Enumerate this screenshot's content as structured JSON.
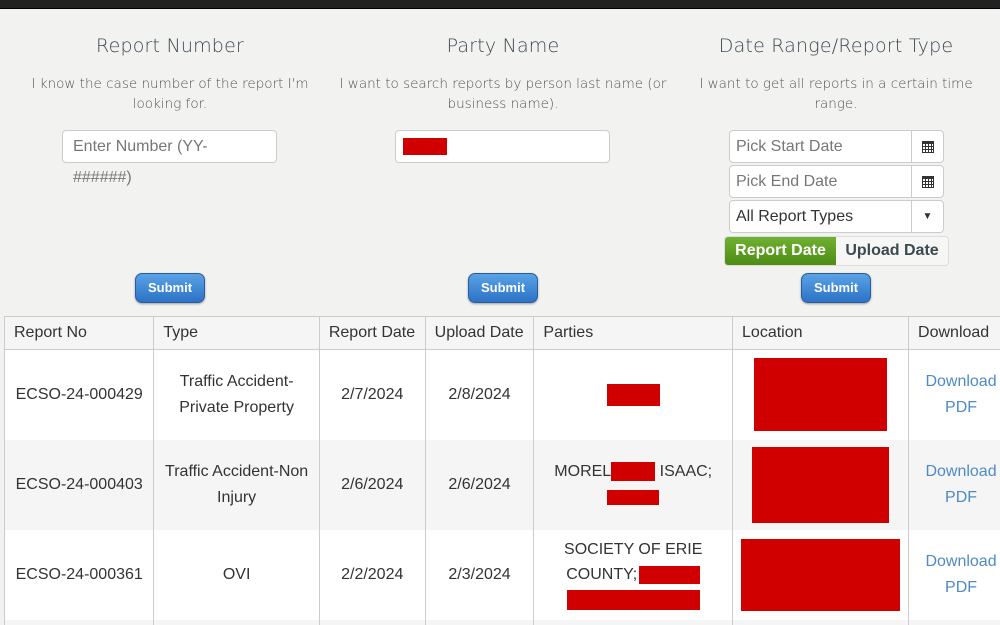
{
  "search": {
    "report_number": {
      "title": "Report Number",
      "description": "I know the case number of the report I'm looking for.",
      "input_placeholder": "Enter Number (YY-######)",
      "submit_label": "Submit"
    },
    "party_name": {
      "title": "Party Name",
      "description": "I want to search reports by person last name (or business name).",
      "input_value": "[redacted]",
      "submit_label": "Submit"
    },
    "date_range": {
      "title": "Date Range/Report Type",
      "description": "I want to get all reports in a certain time range.",
      "start_placeholder": "Pick Start Date",
      "end_placeholder": "Pick End Date",
      "report_type_selected": "All Report Types",
      "date_toggle": {
        "options": [
          "Report Date",
          "Upload Date"
        ],
        "active": "Report Date",
        "active_color": "#5a9e1e"
      },
      "submit_label": "Submit"
    }
  },
  "table": {
    "headers": [
      "Report No",
      "Type",
      "Report Date",
      "Upload Date",
      "Parties",
      "Location",
      "Download"
    ],
    "rows": [
      {
        "report_no": "ECSO-24-000429",
        "type": "Traffic Accident-Private Property",
        "report_date": "2/7/2024",
        "upload_date": "2/8/2024",
        "parties_text": "",
        "location": "[redacted]",
        "download_label": "Download PDF"
      },
      {
        "report_no": "ECSO-24-000403",
        "type": "Traffic Accident-Non Injury",
        "report_date": "2/6/2024",
        "upload_date": "2/6/2024",
        "parties_prefix": "MOREL",
        "parties_suffix": "ISAAC;",
        "location": "[redacted]",
        "download_label": "Download PDF"
      },
      {
        "report_no": "ECSO-24-000361",
        "type": "OVI",
        "report_date": "2/2/2024",
        "upload_date": "2/3/2024",
        "parties_line1": "SOCIETY OF ERIE",
        "parties_line2": "COUNTY;",
        "location": "[redacted]",
        "download_label": "Download PDF"
      }
    ]
  },
  "colors": {
    "redaction": "#d10000",
    "link": "#4f8ac4",
    "submit_button": "#3a86d8"
  }
}
